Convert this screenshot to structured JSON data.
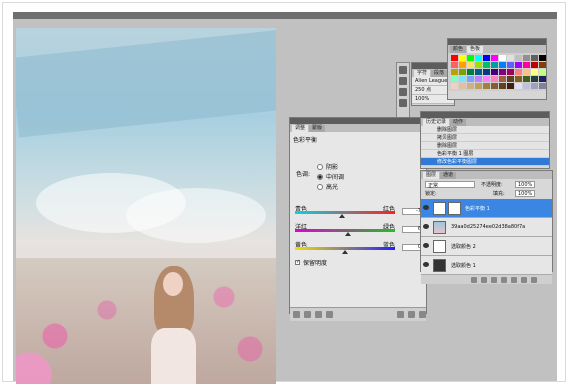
{
  "adjustments": {
    "tabs": [
      "调整",
      "蒙版"
    ],
    "title": "色彩平衡",
    "tone_label": "色调:",
    "tones": [
      "阴影",
      "中间调",
      "高光"
    ],
    "selected_tone": "中间调",
    "sliders": [
      {
        "left": "青色",
        "right": "红色",
        "value": "-7",
        "position": 0.47,
        "gradient": "linear-gradient(90deg,#00d6e6,#ff2020)"
      },
      {
        "left": "洋红",
        "right": "绿色",
        "value": "6",
        "position": 0.53,
        "gradient": "linear-gradient(90deg,#e000d0,#20c020)"
      },
      {
        "left": "黄色",
        "right": "蓝色",
        "value": "0",
        "position": 0.5,
        "gradient": "linear-gradient(90deg,#f0e000,#2020ff)"
      }
    ],
    "preserve_luminosity": "保留明度",
    "preserve_checked": true
  },
  "character": {
    "tabs": [
      "字符",
      "段落"
    ],
    "font": "Alien League",
    "size": "250 点",
    "scale": "100%"
  },
  "swatches": {
    "tabs": [
      "颜色",
      "色板"
    ],
    "colors": [
      "#ff0000",
      "#ffff00",
      "#00ff00",
      "#00ffff",
      "#0000ff",
      "#ff00ff",
      "#ffffff",
      "#e0e0e0",
      "#c0c0c0",
      "#909090",
      "#606060",
      "#000000",
      "#ff6060",
      "#ffa000",
      "#ffe060",
      "#a0e000",
      "#00c060",
      "#00a0a0",
      "#0080ff",
      "#6060ff",
      "#a000ff",
      "#ff00a0",
      "#c00000",
      "#804000",
      "#c0a000",
      "#80a000",
      "#008040",
      "#006080",
      "#004080",
      "#400080",
      "#800080",
      "#a00060",
      "#ff8080",
      "#ffc080",
      "#ffff80",
      "#c0ff80",
      "#80ffc0",
      "#80e0ff",
      "#80a0ff",
      "#c080ff",
      "#ff80ff",
      "#ff80c0",
      "#a06040",
      "#604020",
      "#806020",
      "#406020",
      "#204040",
      "#202060",
      "#f0d0c0",
      "#e0c0a0",
      "#d0b080",
      "#c0a060",
      "#a08040",
      "#806030",
      "#604020",
      "#402010",
      "#e0e0f0",
      "#c0c0e0",
      "#a0a0c0",
      "#8080a0"
    ],
    "bottom_value": "100%"
  },
  "history": {
    "tabs": [
      "历史记录",
      "动作"
    ],
    "items": [
      "删除图层",
      "拷贝图层",
      "删除图层",
      "色彩平衡 1 图层",
      "修改色彩平衡图层"
    ]
  },
  "layers": {
    "tabs": [
      "图层",
      "通道"
    ],
    "blend_mode": "正常",
    "opacity_label": "不透明度:",
    "opacity": "100%",
    "lock_label": "锁定:",
    "fill_label": "填充:",
    "fill": "100%",
    "items": [
      {
        "name": "色彩平衡 1",
        "selected": true,
        "thumb": "white",
        "mask": true
      },
      {
        "name": "39aa0d25274ee02d38a80f7a",
        "selected": false,
        "thumb": "photo",
        "mask": false
      },
      {
        "name": "选取颜色 2",
        "selected": false,
        "thumb": "white",
        "mask": false
      },
      {
        "name": "选取颜色 1",
        "selected": false,
        "thumb": "dark",
        "mask": false
      }
    ]
  }
}
